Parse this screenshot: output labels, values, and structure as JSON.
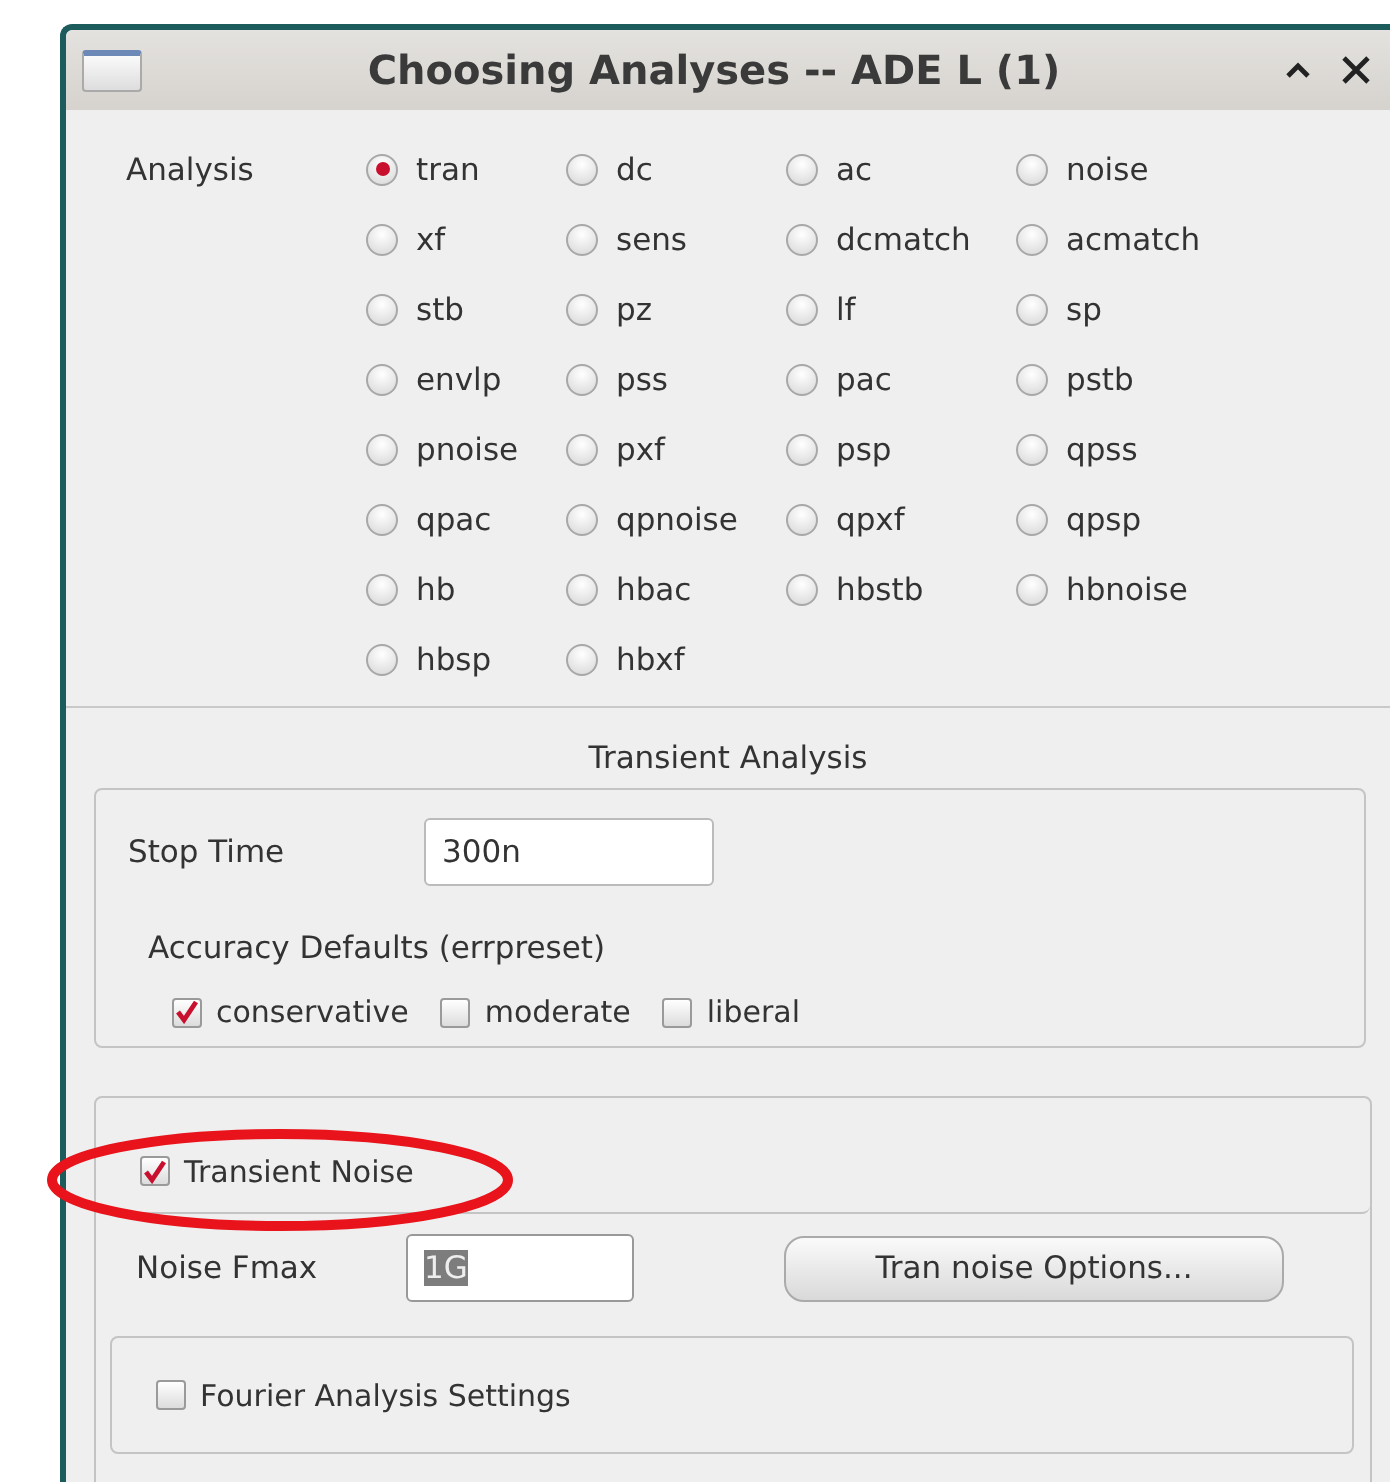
{
  "window": {
    "title": "Choosing Analyses -- ADE L (1)"
  },
  "analysis": {
    "label": "Analysis",
    "options": [
      {
        "label": "tran",
        "selected": true
      },
      {
        "label": "dc",
        "selected": false
      },
      {
        "label": "ac",
        "selected": false
      },
      {
        "label": "noise",
        "selected": false
      },
      {
        "label": "xf",
        "selected": false
      },
      {
        "label": "sens",
        "selected": false
      },
      {
        "label": "dcmatch",
        "selected": false
      },
      {
        "label": "acmatch",
        "selected": false
      },
      {
        "label": "stb",
        "selected": false
      },
      {
        "label": "pz",
        "selected": false
      },
      {
        "label": "lf",
        "selected": false
      },
      {
        "label": "sp",
        "selected": false
      },
      {
        "label": "envlp",
        "selected": false
      },
      {
        "label": "pss",
        "selected": false
      },
      {
        "label": "pac",
        "selected": false
      },
      {
        "label": "pstb",
        "selected": false
      },
      {
        "label": "pnoise",
        "selected": false
      },
      {
        "label": "pxf",
        "selected": false
      },
      {
        "label": "psp",
        "selected": false
      },
      {
        "label": "qpss",
        "selected": false
      },
      {
        "label": "qpac",
        "selected": false
      },
      {
        "label": "qpnoise",
        "selected": false
      },
      {
        "label": "qpxf",
        "selected": false
      },
      {
        "label": "qpsp",
        "selected": false
      },
      {
        "label": "hb",
        "selected": false
      },
      {
        "label": "hbac",
        "selected": false
      },
      {
        "label": "hbstb",
        "selected": false
      },
      {
        "label": "hbnoise",
        "selected": false
      },
      {
        "label": "hbsp",
        "selected": false
      },
      {
        "label": "hbxf",
        "selected": false
      }
    ]
  },
  "transient": {
    "title": "Transient Analysis",
    "stop_time": {
      "label": "Stop Time",
      "value": "300n"
    },
    "accuracy": {
      "label": "Accuracy Defaults (errpreset)",
      "options": [
        {
          "label": "conservative",
          "checked": true
        },
        {
          "label": "moderate",
          "checked": false
        },
        {
          "label": "liberal",
          "checked": false
        }
      ]
    }
  },
  "transient_noise": {
    "label": "Transient Noise",
    "checked": true,
    "fmax": {
      "label": "Noise Fmax",
      "value": "1G"
    },
    "options_button": "Tran noise Options..."
  },
  "fourier": {
    "label": "Fourier Analysis Settings",
    "checked": false
  }
}
